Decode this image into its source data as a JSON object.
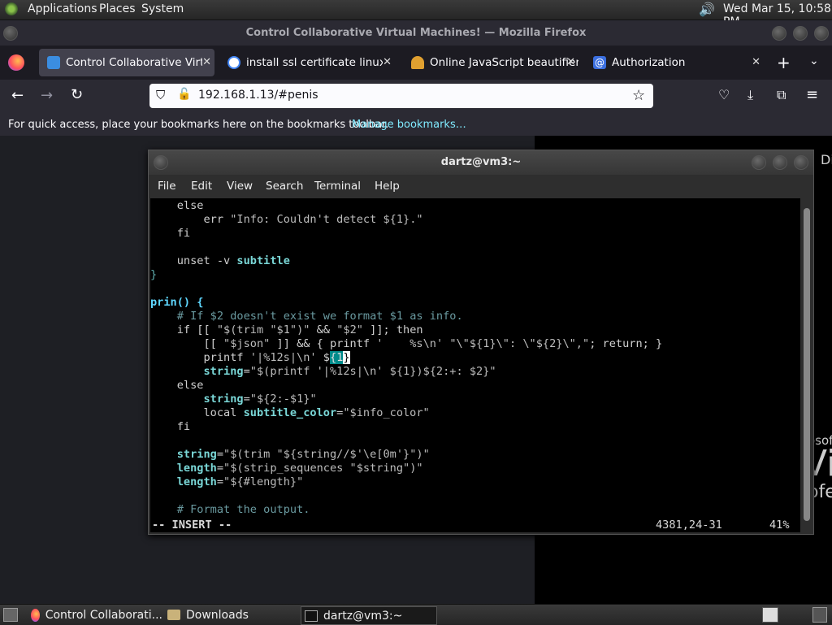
{
  "panel": {
    "applications": "Applications",
    "places": "Places",
    "system": "System",
    "clock": "Wed Mar 15, 10:58 PM"
  },
  "firefox": {
    "window_title": "Control Collaborative Virtual Machines! — Mozilla Firefox",
    "tabs": [
      {
        "label": "Control Collaborative Virtual",
        "active": true
      },
      {
        "label": "install ssl certificate linux - G",
        "active": false
      },
      {
        "label": "Online JavaScript beautifier",
        "active": false
      },
      {
        "label": "Authorization",
        "active": false
      }
    ],
    "url": "192.168.1.13/#penis",
    "bookmarks_text": "For quick access, place your bookmarks here on the bookmarks toolbar.",
    "bookmarks_link": "Manage bookmarks…"
  },
  "right_pane": {
    "text_top": "Di",
    "text_a": "osof",
    "text_b": "Vi",
    "text_c": "ofe"
  },
  "terminal": {
    "title": "dartz@vm3:~",
    "menu": [
      "File",
      "Edit",
      "View",
      "Search",
      "Terminal",
      "Help"
    ],
    "mode": "-- INSERT --",
    "position": "4381,24-31",
    "percent": "41%"
  },
  "taskbar": {
    "items": [
      {
        "label": "Control Collaborati...",
        "active": false
      },
      {
        "label": "Downloads",
        "active": false
      },
      {
        "label": "dartz@vm3:~",
        "active": true
      }
    ]
  },
  "colors": {
    "firefox_dark": "#2b2a33",
    "tab_active": "#42414d",
    "link": "#80ebff",
    "term_cyan": "#5fafaf"
  }
}
